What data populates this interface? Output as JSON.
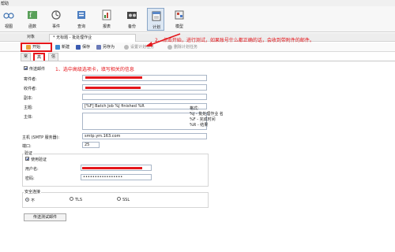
{
  "menubar": {
    "help": "帮助"
  },
  "ribbon": {
    "items": [
      {
        "label": "视图",
        "icon": "glasses-icon"
      },
      {
        "label": "函数",
        "icon": "function-icon"
      },
      {
        "label": "事件",
        "icon": "event-icon"
      },
      {
        "label": "查询",
        "icon": "query-icon"
      },
      {
        "label": "报表",
        "icon": "report-icon"
      },
      {
        "label": "备份",
        "icon": "backup-icon"
      },
      {
        "label": "计划",
        "icon": "schedule-icon"
      },
      {
        "label": "模型",
        "icon": "model-icon"
      }
    ],
    "active": "计划"
  },
  "objbar": {
    "object_tab": "对象",
    "doc_tab": "* 无标题 - 批处理作业"
  },
  "toolbar": {
    "start": "开始",
    "new": "新建",
    "save": "保存",
    "save_as": "另存为",
    "set_task": "设置计划任务",
    "delete_task": "删除计划任务"
  },
  "tabs": [
    "常规",
    "高级",
    "信息日志"
  ],
  "selected_tab": "高级",
  "form": {
    "send_email": "传送邮件",
    "sender_label": "寄件者:",
    "recipient_label": "收件者:",
    "cc_label": "副本:",
    "subject_label": "主题:",
    "subject_value": "[%F] Batch Job %J finished %R",
    "body_label": "主体:",
    "format_title": "格式:",
    "format_lines": [
      "%J - 批处理作业 名",
      "%F - 完成时间",
      "%R - 结果"
    ],
    "host_label": "主机 (SMTP 服务器):",
    "host_value": "smtp.ym.163.com",
    "port_label": "端口:",
    "port_value": "25",
    "auth_group": "验证",
    "use_auth": "使用验证",
    "user_label": "用户名:",
    "password_label": "密码:",
    "password_value": "•••••••••••••••••",
    "security_group": "安全连接",
    "security_options": [
      "不",
      "TLS",
      "SSL"
    ],
    "security_selected": "不",
    "test_button": "传送测试邮件"
  },
  "annotations": {
    "step1": "1、选中高级选项卡，填写相关的信息",
    "step2": "2、点击开始，进行测试，如果账号什么都正确的话，会收到带附件的邮件。"
  },
  "colors": {
    "annotation": "#e5161b",
    "accent": "#1a3a8a"
  }
}
